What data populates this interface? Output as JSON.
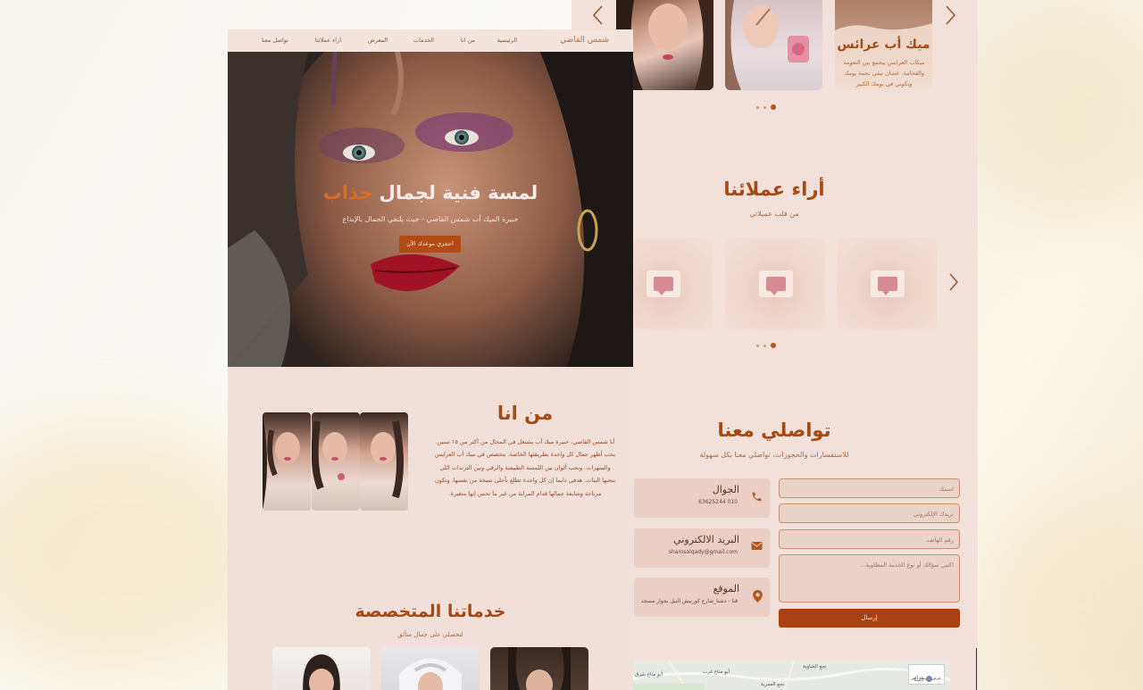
{
  "nav": {
    "brand": "شمس القاضي",
    "items": [
      "الرئيسية",
      "من انا",
      "الخدمات",
      "المعرض",
      "اراء عملائنا",
      "تواصل معنا"
    ]
  },
  "hero": {
    "title_main": "لمسة فنية لجمال",
    "title_accent": "جذاب",
    "subtitle": "خبيرة الميك أب شمس القاضي - حيث يلتقي الجمال بالإبداع",
    "cta": "احجزي موعدك الآن"
  },
  "about": {
    "title": "من انا",
    "text": "أنا شمس القاضي، خبيرة ميك أب بشتغل في المجال من أكثر من ١٥ سنين. بحب أظهر جمال كل واحدة بطريقتها الخاصة. بتخصص في ميك أب العرايس والسهرات. وبحب ألوان بين اللمسة الطبيعية والرقي وبين الترندات اللي بتحبها البنات. هدفي دايما إن كل واحدة تطلع بأحلى نسخة من نفسها، وتكون مرتاحة وشايفة جمالها قدام المراية من غير ما تحس إنها متغيرة."
  },
  "services": {
    "title": "خدماتنا المتخصصة",
    "subtitle": "لتحصلي على جمال متألق",
    "card": {
      "title": "ميك أب عرائس",
      "text": "ميكاب العرايس بيجمع بين النعومة والفخامة، عشان تبقي نجمة يومك وتكوني في يومك الكبير"
    }
  },
  "testimonials": {
    "title": "أراء عملائنا",
    "subtitle": "من قلب عميلاتي"
  },
  "contact": {
    "title": "تواصلي معنا",
    "subtitle": "للاستفسارات والحجوزات، تواصلي معنا بكل سهولة",
    "phone_label": "الجوال",
    "phone_value": "010 63625244",
    "email_label": "البريد الالكتروني",
    "email_value": "shamsalqady@gmail.com",
    "location_label": "الموقع",
    "location_value": "قنا - دشنا_شارع كورنيش النيل بجوار مسجد",
    "form": {
      "name_placeholder": "اسمك",
      "email_placeholder": "بريدك الإلكتروني",
      "phone_placeholder": "رقم الهاتف",
      "message_placeholder": "اكتبي سؤالك أو نوع الخدمة المطلوبة...",
      "submit": "إرسال"
    }
  },
  "map": {
    "labels": [
      "نجع الشاوية",
      "أبو مناع غرب",
      "أبو مناع شرق",
      "نجع العمرية",
      "عرض خريطة أكبر",
      "دشنا"
    ]
  },
  "colors": {
    "accent": "#b3581f",
    "title": "#a54a14",
    "button": "#a9400f",
    "panel": "#f1e0da"
  }
}
